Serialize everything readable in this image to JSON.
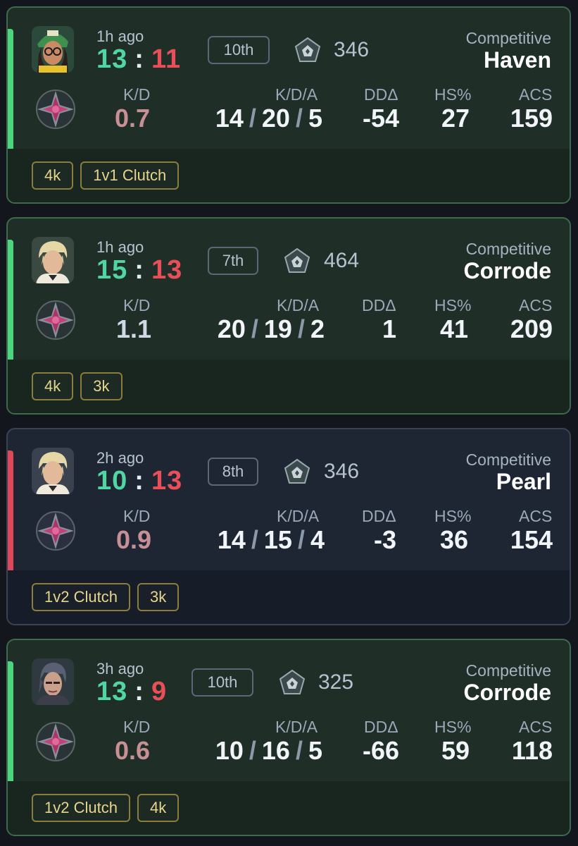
{
  "matches": [
    {
      "result": "win",
      "time_ago": "1h ago",
      "score_team": "13",
      "score_enemy": "11",
      "placement": "10th",
      "rr_value": "346",
      "mode": "Competitive",
      "map": "Haven",
      "kd_label": "K/D",
      "kd_value": "0.7",
      "kda_label": "K/D/A",
      "kills": "14",
      "deaths": "20",
      "assists": "5",
      "dd_label": "DDΔ",
      "dd_value": "-54",
      "hs_label": "HS%",
      "hs_value": "27",
      "acs_label": "ACS",
      "acs_value": "159",
      "tags": [
        "4k",
        "1v1 Clutch"
      ],
      "agent_icon": "agent-killjoy-portrait"
    },
    {
      "result": "win",
      "time_ago": "1h ago",
      "score_team": "15",
      "score_enemy": "13",
      "placement": "7th",
      "rr_value": "464",
      "mode": "Competitive",
      "map": "Corrode",
      "kd_label": "K/D",
      "kd_value": "1.1",
      "kda_label": "K/D/A",
      "kills": "20",
      "deaths": "19",
      "assists": "2",
      "dd_label": "DDΔ",
      "dd_value": "1",
      "hs_label": "HS%",
      "hs_value": "41",
      "acs_label": "ACS",
      "acs_value": "209",
      "tags": [
        "4k",
        "3k"
      ],
      "agent_icon": "agent-chamber-portrait"
    },
    {
      "result": "loss",
      "time_ago": "2h ago",
      "score_team": "10",
      "score_enemy": "13",
      "placement": "8th",
      "rr_value": "346",
      "mode": "Competitive",
      "map": "Pearl",
      "kd_label": "K/D",
      "kd_value": "0.9",
      "kda_label": "K/D/A",
      "kills": "14",
      "deaths": "15",
      "assists": "4",
      "dd_label": "DDΔ",
      "dd_value": "-3",
      "hs_label": "HS%",
      "hs_value": "36",
      "acs_label": "ACS",
      "acs_value": "154",
      "tags": [
        "1v2 Clutch",
        "3k"
      ],
      "agent_icon": "agent-chamber-portrait"
    },
    {
      "result": "win",
      "time_ago": "3h ago",
      "score_team": "13",
      "score_enemy": "9",
      "placement": "10th",
      "rr_value": "325",
      "mode": "Competitive",
      "map": "Corrode",
      "kd_label": "K/D",
      "kd_value": "0.6",
      "kda_label": "K/D/A",
      "kills": "10",
      "deaths": "16",
      "assists": "5",
      "dd_label": "DDΔ",
      "dd_value": "-66",
      "hs_label": "HS%",
      "hs_value": "59",
      "acs_label": "ACS",
      "acs_value": "118",
      "tags": [
        "1v2 Clutch",
        "4k"
      ],
      "agent_icon": "agent-vyse-portrait"
    }
  ],
  "colors": {
    "win_accent": "#4bd57e",
    "loss_accent": "#e0485a",
    "score_team": "#4fd6a3",
    "score_enemy": "#ea4f59",
    "tag_border": "#8c7d3c",
    "tag_text": "#e6d58c"
  }
}
